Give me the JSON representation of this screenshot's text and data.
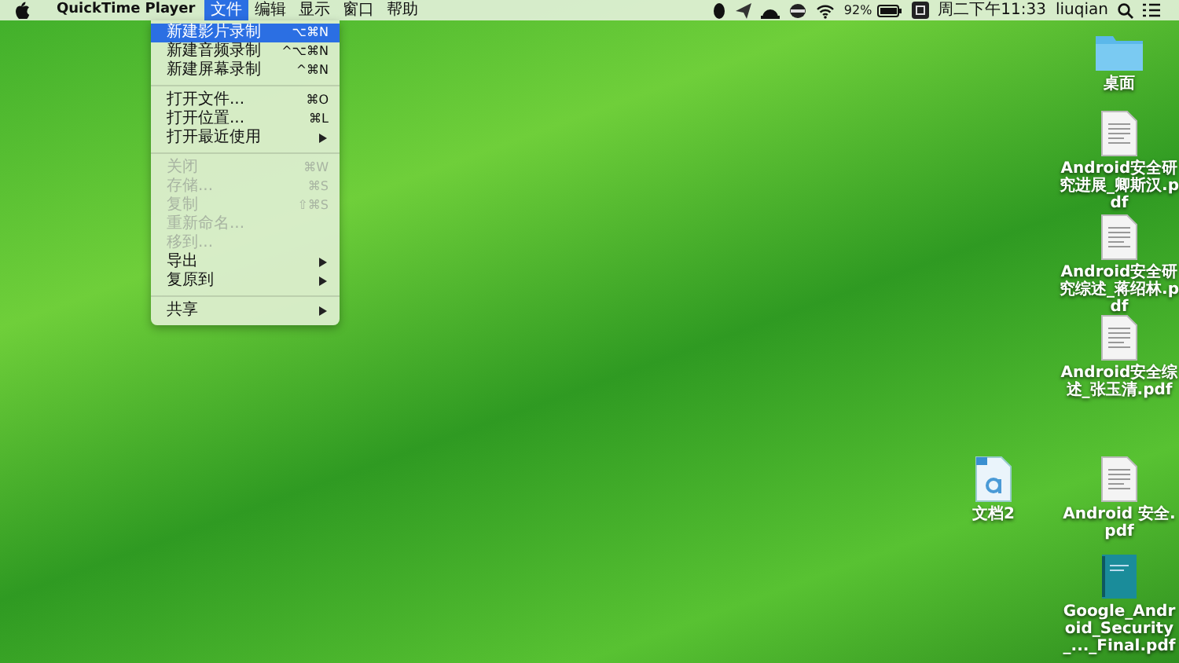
{
  "menu_bar": {
    "app_name": "QuickTime Player",
    "menus": [
      {
        "label": "文件",
        "selected": true
      },
      {
        "label": "编辑",
        "selected": false
      },
      {
        "label": "显示",
        "selected": false
      },
      {
        "label": "窗口",
        "selected": false
      },
      {
        "label": "帮助",
        "selected": false
      }
    ],
    "status": {
      "battery_percent": "92%",
      "clock": "周二下午11:33",
      "user": "liuqian"
    }
  },
  "file_menu": [
    {
      "kind": "item",
      "label": "新建影片录制",
      "shortcut": "⌥⌘N",
      "selected": true,
      "disabled": false,
      "submenu": false
    },
    {
      "kind": "item",
      "label": "新建音频录制",
      "shortcut": "^⌥⌘N",
      "selected": false,
      "disabled": false,
      "submenu": false
    },
    {
      "kind": "item",
      "label": "新建屏幕录制",
      "shortcut": "^⌘N",
      "selected": false,
      "disabled": false,
      "submenu": false
    },
    {
      "kind": "separator"
    },
    {
      "kind": "item",
      "label": "打开文件...",
      "shortcut": "⌘O",
      "selected": false,
      "disabled": false,
      "submenu": false
    },
    {
      "kind": "item",
      "label": "打开位置...",
      "shortcut": "⌘L",
      "selected": false,
      "disabled": false,
      "submenu": false
    },
    {
      "kind": "item",
      "label": "打开最近使用",
      "selected": false,
      "disabled": false,
      "submenu": true
    },
    {
      "kind": "separator"
    },
    {
      "kind": "item",
      "label": "关闭",
      "shortcut": "⌘W",
      "selected": false,
      "disabled": true,
      "submenu": false
    },
    {
      "kind": "item",
      "label": "存储...",
      "shortcut": "⌘S",
      "selected": false,
      "disabled": true,
      "submenu": false
    },
    {
      "kind": "item",
      "label": "复制",
      "shortcut": "⇧⌘S",
      "selected": false,
      "disabled": true,
      "submenu": false
    },
    {
      "kind": "item",
      "label": "重新命名...",
      "selected": false,
      "disabled": true,
      "submenu": false
    },
    {
      "kind": "item",
      "label": "移到...",
      "selected": false,
      "disabled": true,
      "submenu": false
    },
    {
      "kind": "item",
      "label": "导出",
      "selected": false,
      "disabled": false,
      "submenu": true
    },
    {
      "kind": "item",
      "label": "复原到",
      "selected": false,
      "disabled": false,
      "submenu": true
    },
    {
      "kind": "separator"
    },
    {
      "kind": "item",
      "label": "共享",
      "selected": false,
      "disabled": false,
      "submenu": true
    }
  ],
  "desktop_icons": [
    {
      "kind": "folder",
      "label": "桌面"
    },
    {
      "kind": "pdf",
      "label": "Android安全研究进展_卿斯汉.pdf"
    },
    {
      "kind": "pdf",
      "label": "Android安全研究综述_蒋绍林.pdf"
    },
    {
      "kind": "pdf",
      "label": "Android安全综述_张玉清.pdf"
    },
    {
      "kind": "doc",
      "label": "文档2"
    },
    {
      "kind": "pdf",
      "label": "Android 安全.pdf"
    },
    {
      "kind": "book",
      "label": "Google_Android_Security_..._Final.pdf"
    }
  ]
}
